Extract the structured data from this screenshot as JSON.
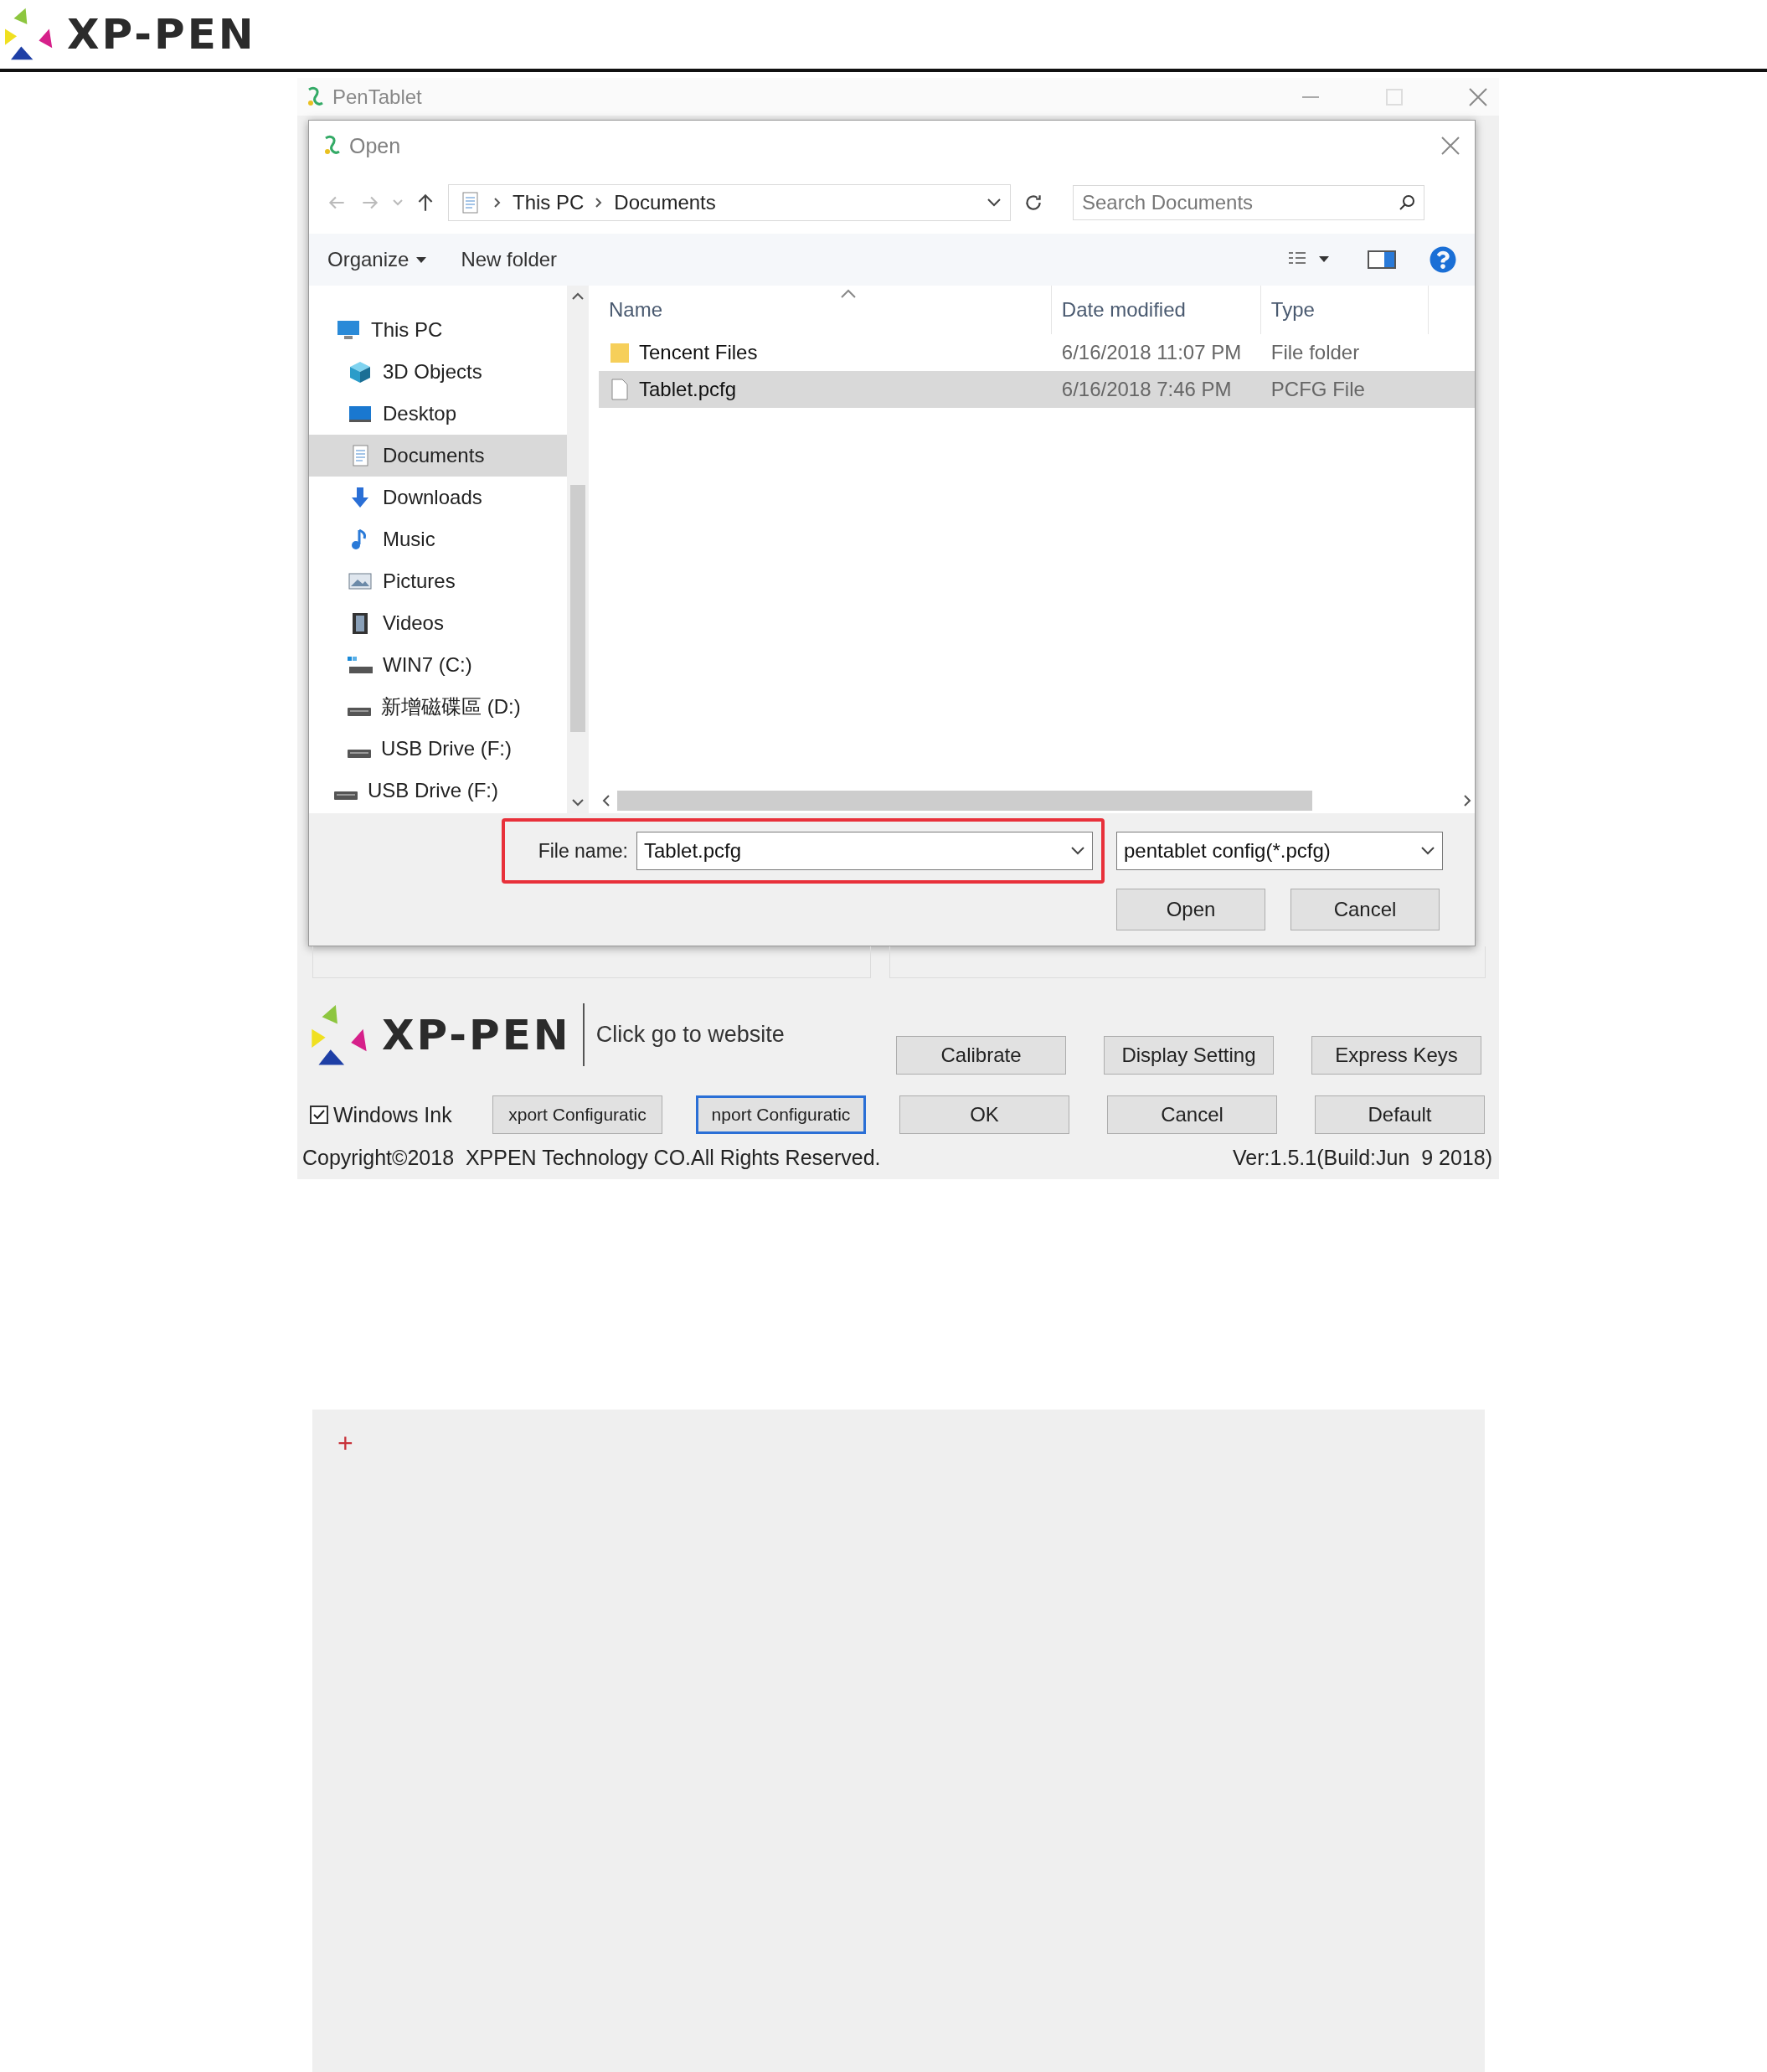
{
  "header": {
    "logo_text": "XP-PEN"
  },
  "app_window": {
    "title": "PenTablet"
  },
  "open_dialog": {
    "title": "Open",
    "breadcrumb": [
      "This PC",
      "Documents"
    ],
    "search": {
      "placeholder": "Search Documents"
    },
    "toolbar": [
      "Organize",
      "New folder"
    ],
    "nav": [
      {
        "label": "This PC",
        "kind": "computer",
        "selected": false,
        "children": [
          {
            "label": "3D Objects",
            "kind": "cube",
            "selected": false
          },
          {
            "label": "Desktop",
            "kind": "desktop",
            "selected": false
          },
          {
            "label": "Documents",
            "kind": "document",
            "selected": true
          },
          {
            "label": "Downloads",
            "kind": "download",
            "selected": false
          },
          {
            "label": "Music",
            "kind": "music",
            "selected": false
          },
          {
            "label": "Pictures",
            "kind": "pictures",
            "selected": false
          },
          {
            "label": "Videos",
            "kind": "videos",
            "selected": false
          },
          {
            "label": "WIN7 (C:)",
            "kind": "system-drive",
            "selected": false
          },
          {
            "label": "新增磁碟區 (D:)",
            "kind": "drive",
            "selected": false
          },
          {
            "label": "USB Drive (F:)",
            "kind": "drive",
            "selected": false
          }
        ]
      },
      {
        "label": "USB Drive (F:)",
        "kind": "drive",
        "selected": false
      }
    ],
    "columns": [
      "Name",
      "Date modified",
      "Type"
    ],
    "files": [
      {
        "name": "Tencent Files",
        "date": "6/16/2018 11:07 PM",
        "type": "File folder",
        "kind": "folder",
        "selected": false
      },
      {
        "name": "Tablet.pcfg",
        "date": "6/16/2018 7:46 PM",
        "type": "PCFG File",
        "kind": "file",
        "selected": true
      }
    ],
    "file_name": {
      "label": "File name:",
      "value": "Tablet.pcfg"
    },
    "file_type": "pentablet config(*.pcfg)",
    "buttons": [
      "Open",
      "Cancel"
    ]
  },
  "bottom": {
    "logo_text": "XP-PEN",
    "website_link": "Click go to website",
    "buttons_row1": [
      "Calibrate",
      "Display Setting",
      "Express Keys"
    ],
    "windows_ink": {
      "label": "Windows Ink",
      "checked": true
    },
    "buttons_row2": [
      {
        "label": "xport Configuratic",
        "focused": false
      },
      {
        "label": "nport Configuratic",
        "focused": true
      },
      {
        "label": "OK",
        "focused": false
      },
      {
        "label": "Cancel",
        "focused": false
      },
      {
        "label": "Default",
        "focused": false
      }
    ],
    "copyright": "Copyright©2018  XPPEN Technology CO.All Rights Reserved.",
    "version": "Ver:1.5.1(Build:Jun  9 2018)"
  },
  "lower_panel": {
    "marker": "+"
  }
}
